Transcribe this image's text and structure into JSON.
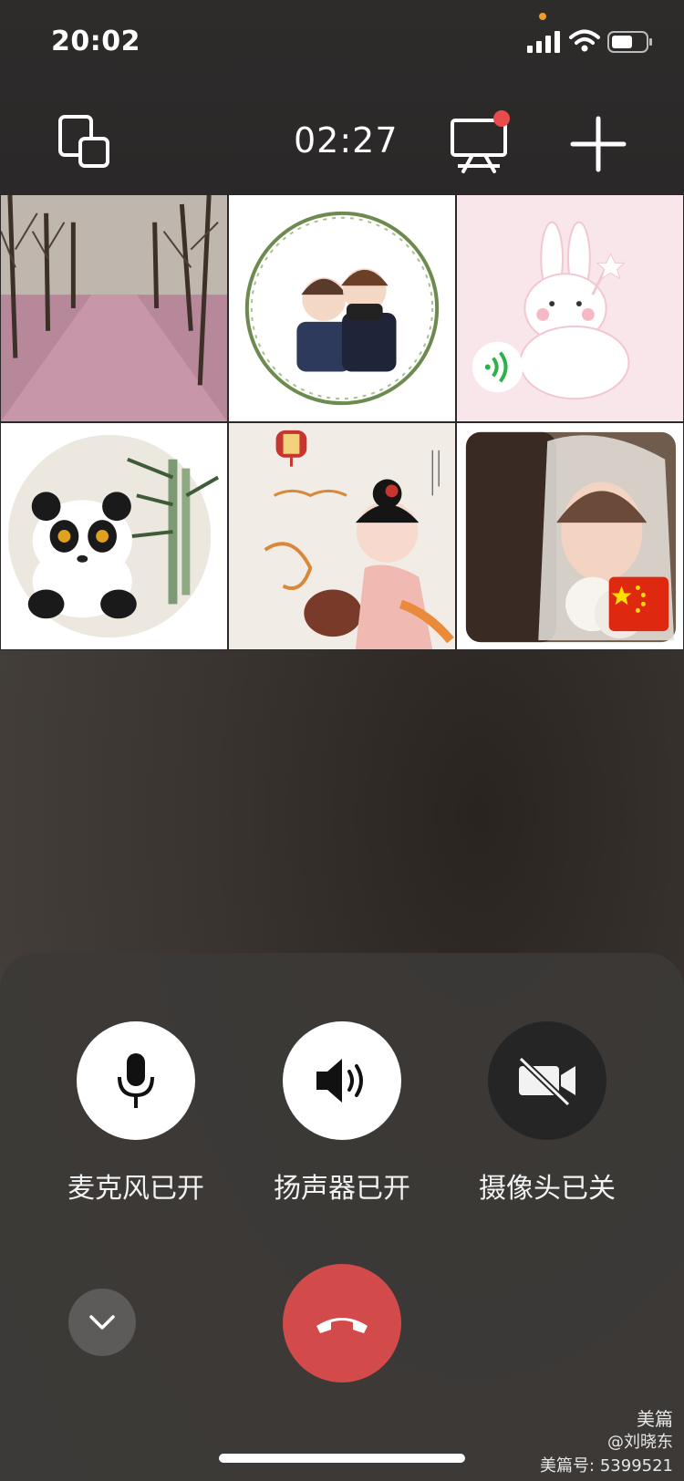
{
  "status_bar": {
    "time": "20:02"
  },
  "header": {
    "call_timer": "02:27"
  },
  "participants": [
    {
      "name": "participant-1",
      "image": "tree-grove"
    },
    {
      "name": "participant-2",
      "image": "couple-wreath"
    },
    {
      "name": "participant-3",
      "image": "bunny"
    },
    {
      "name": "participant-4",
      "image": "panda-bamboo"
    },
    {
      "name": "participant-5",
      "image": "chinese-girl"
    },
    {
      "name": "participant-6",
      "image": "bride-flag"
    }
  ],
  "controls": {
    "mic_label": "麦克风已开",
    "speaker_label": "扬声器已开",
    "camera_label": "摄像头已关"
  },
  "watermark": {
    "brand": "美篇",
    "author": "@刘晓东",
    "id": "美篇号: 5399521"
  },
  "colors": {
    "hangup": "#d34a4a",
    "screen_share_dot": "#e84c4c",
    "orange_indicator": "#f09a2c"
  }
}
